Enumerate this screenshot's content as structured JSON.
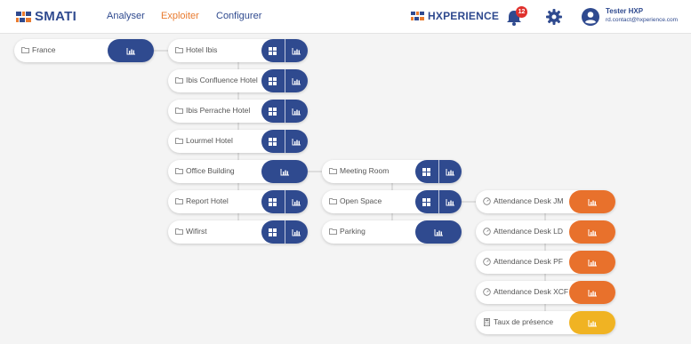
{
  "header": {
    "logo_text": "SMATI",
    "nav": [
      "Analyser",
      "Exploiter",
      "Configurer"
    ],
    "active_nav": "Exploiter",
    "brand_text": "HXPERIENCE",
    "notification_count": "12",
    "user_name": "Tester HXP",
    "user_email": "rd.contact@hxperience.com"
  },
  "colors": {
    "primary": "#2f4a8f",
    "accent": "#e97b2f",
    "kpi_orange": "#e8712c",
    "kpi_yellow": "#f0b323",
    "badge_red": "#e0312d"
  },
  "tree": {
    "root": {
      "label": "France",
      "icon": "folder-icon"
    },
    "hotels": [
      {
        "label": "Hotel Ibis",
        "icon": "folder-icon"
      },
      {
        "label": "Ibis Confluence Hotel",
        "icon": "folder-icon"
      },
      {
        "label": "Ibis Perrache Hotel",
        "icon": "folder-icon"
      },
      {
        "label": "Lourmel Hotel",
        "icon": "folder-icon"
      },
      {
        "label": "Office Building",
        "icon": "folder-icon"
      },
      {
        "label": "Report Hotel",
        "icon": "folder-icon"
      },
      {
        "label": "Wifirst",
        "icon": "folder-icon"
      }
    ],
    "rooms": [
      {
        "label": "Meeting Room",
        "icon": "folder-icon"
      },
      {
        "label": "Open Space",
        "icon": "folder-icon"
      },
      {
        "label": "Parking",
        "icon": "folder-icon"
      }
    ],
    "desks": [
      {
        "label": "Attendance Desk JM",
        "icon": "gauge-icon"
      },
      {
        "label": "Attendance Desk LD",
        "icon": "gauge-icon"
      },
      {
        "label": "Attendance Desk PF",
        "icon": "gauge-icon"
      },
      {
        "label": "Attendance Desk XCF",
        "icon": "gauge-icon"
      },
      {
        "label": "Taux de présence",
        "icon": "calculator-icon"
      }
    ]
  }
}
